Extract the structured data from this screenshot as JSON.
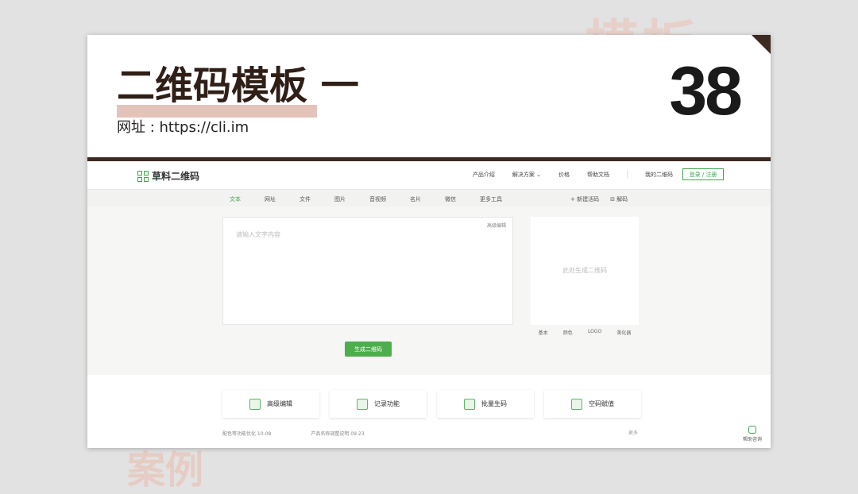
{
  "watermark": {
    "top": "模板",
    "bottom": "案例"
  },
  "slide": {
    "title": "二维码模板 一",
    "subtitle": "网址 : https://cli.im",
    "number": "38"
  },
  "app": {
    "logo": "草料二维码",
    "nav": [
      "产品介绍",
      "解决方案 ⌄",
      "价格",
      "帮助文档",
      "我的二维码"
    ],
    "login": "登录 / 注册",
    "tabs": [
      "文本",
      "网址",
      "文件",
      "图片",
      "音视频",
      "名片",
      "微信",
      "更多工具"
    ],
    "active_tab": "文本",
    "tab_actions": [
      "+ 新建活码",
      "⊟ 解码"
    ],
    "editor": {
      "link": "高级编辑",
      "placeholder": "请输入文字内容"
    },
    "qr": {
      "placeholder": "此处生成二维码",
      "options": [
        "基本",
        "颜色",
        "LOGO",
        "美化器"
      ]
    },
    "generate": "生成二维码",
    "features": [
      "高级编辑",
      "记录功能",
      "批量生码",
      "空码赋值"
    ],
    "news": [
      "配色等功能优化  10-08",
      "产品名称调整说明  09-23"
    ],
    "more": "更多",
    "help": "帮助咨询"
  },
  "colors": {
    "accent": "#3fa34d",
    "title": "#2f1f17",
    "bar": "#3d2a22"
  }
}
